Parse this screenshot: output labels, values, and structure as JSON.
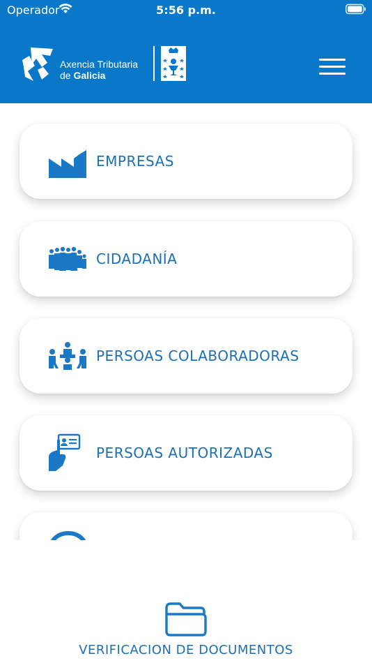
{
  "status_bar": {
    "carrier": "Operador",
    "time": "5:56 p.m."
  },
  "header": {
    "brand_line1": "Axencia Tributaria",
    "brand_line2_prefix": "de",
    "brand_line2_bold": "Galicia",
    "background_color": "#0a78c8"
  },
  "menu": [
    {
      "label": "EMPRESAS",
      "icon": "factory-icon"
    },
    {
      "label": "CIDADANÍA",
      "icon": "citizens-icon"
    },
    {
      "label": "PERSOAS COLABORADORAS",
      "icon": "collaborators-icon"
    },
    {
      "label": "PERSOAS AUTORIZADAS",
      "icon": "authorized-id-icon"
    }
  ],
  "footer": {
    "verify_label": "VERIFICACION DE DOCUMENTOS",
    "icon": "folder-icon"
  },
  "colors": {
    "accent": "#1b6fb3",
    "icon_blue": "#1a78c6"
  }
}
